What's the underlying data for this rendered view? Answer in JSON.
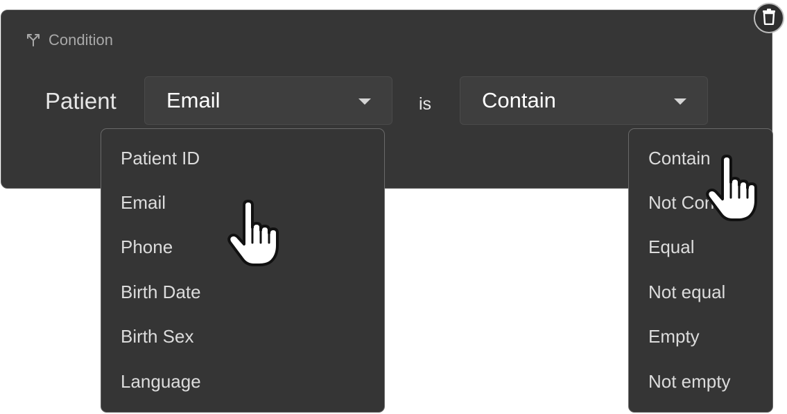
{
  "header": {
    "title": "Condition",
    "icon": "branch-icon"
  },
  "condition": {
    "subject": "Patient",
    "field_value": "Email",
    "connector": "is",
    "operator_value": "Contain"
  },
  "field_menu": {
    "items": [
      "Patient ID",
      "Email",
      "Phone",
      "Birth Date",
      "Birth Sex",
      "Language"
    ]
  },
  "operator_menu": {
    "items": [
      "Contain",
      "Not Contain",
      "Equal",
      "Not equal",
      "Empty",
      "Not empty"
    ]
  },
  "icons": {
    "delete": "trash-icon",
    "cursor": "hand-pointer-icon",
    "dropdown": "caret-down-icon"
  },
  "colors": {
    "panel": "#363636",
    "text": "#dcdcdc",
    "muted": "#a9a9a9"
  }
}
